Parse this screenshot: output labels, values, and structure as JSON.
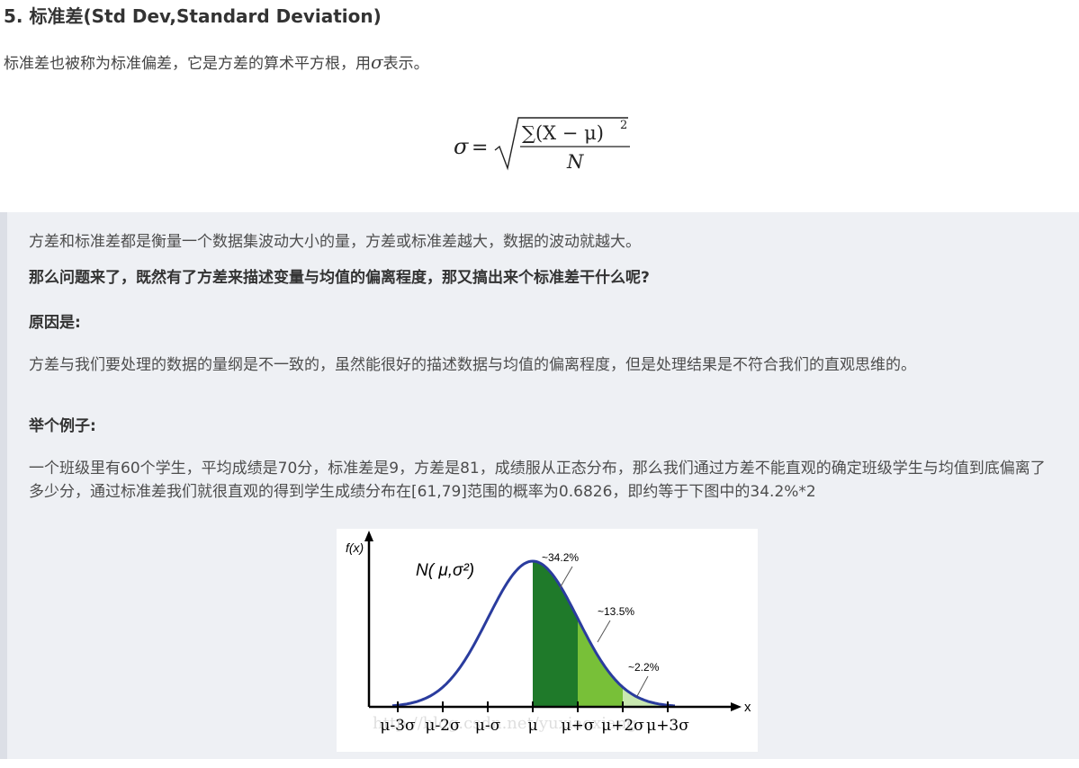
{
  "section_title": "5. 标准差(Std Dev,Standard Deviation)",
  "intro": {
    "before": "标准差也被称为标准偏差，它是方差的算术平方根，用",
    "symbol": "σ",
    "after": "表示。"
  },
  "formula": {
    "lhs": "σ",
    "equals": "=",
    "numerator": "∑(X − μ)",
    "exponent": "2",
    "denominator": "N"
  },
  "quote": {
    "line1": "方差和标准差都是衡量一个数据集波动大小的量，方差或标准差越大，数据的波动就越大。",
    "question": "那么问题来了，既然有了方差来描述变量与均值的偏离程度，那又搞出来个标准差干什么呢?",
    "reason_heading": "原因是:",
    "reason_text": "方差与我们要处理的数据的量纲是不一致的，虽然能很好的描述数据与均值的偏离程度，但是处理结果是不符合我们的直观思维的。",
    "example_heading": "举个例子:",
    "example_text": "一个班级里有60个学生，平均成绩是70分，标准差是9，方差是81，成绩服从正态分布，那么我们通过方差不能直观的确定班级学生与均值到底偏离了多少分，通过标准差我们就很直观的得到学生成绩分布在[61,79]范围的概率为0.6826，即约等于下图中的34.2%*2"
  },
  "figure": {
    "y_label": "f(x)",
    "x_label": "x",
    "curve_label": "N( μ,σ²)",
    "band_labels": [
      "~34.2%",
      "~13.5%",
      "~2.2%"
    ],
    "ticks": [
      "μ-3σ",
      "μ-2σ",
      "μ-σ",
      "μ",
      "μ+σ",
      "μ+2σ",
      "μ+3σ"
    ],
    "watermark": "http://blog.csdn.net/yuxiaoxiang",
    "colors": {
      "curve": "#2a3c9e",
      "band1": "#1f7a2a",
      "band2": "#78c038",
      "band3": "#c9e8b0",
      "axis": "#000000"
    }
  }
}
